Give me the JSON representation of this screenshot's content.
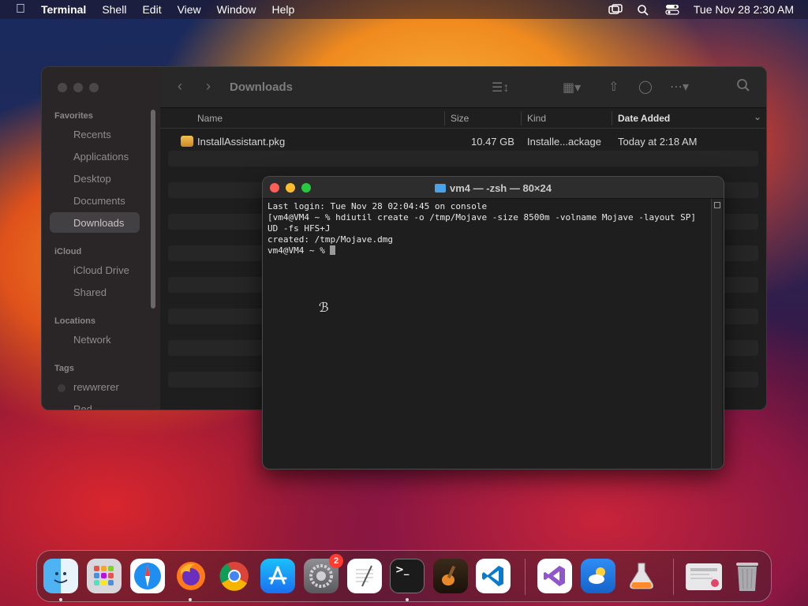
{
  "menubar": {
    "app_name": "Terminal",
    "items": [
      "Shell",
      "Edit",
      "View",
      "Window",
      "Help"
    ],
    "datetime": "Tue Nov 28  2:30 AM"
  },
  "finder": {
    "title": "Downloads",
    "sidebar": {
      "favorites_header": "Favorites",
      "favorites": [
        "Recents",
        "Applications",
        "Desktop",
        "Documents",
        "Downloads"
      ],
      "selected": "Downloads",
      "icloud_header": "iCloud",
      "icloud": [
        "iCloud Drive",
        "Shared"
      ],
      "locations_header": "Locations",
      "locations": [
        "Network"
      ],
      "tags_header": "Tags",
      "tags": [
        "rewwrerer",
        "Red"
      ]
    },
    "columns": {
      "name": "Name",
      "size": "Size",
      "kind": "Kind",
      "date_added": "Date Added"
    },
    "files": [
      {
        "name": "InstallAssistant.pkg",
        "size": "10.47 GB",
        "kind": "Installe...ackage",
        "date_added": "Today at 2:18 AM"
      }
    ]
  },
  "terminal": {
    "title": "vm4 — -zsh — 80×24",
    "lines": [
      "Last login: Tue Nov 28 02:04:45 on console",
      "[vm4@VM4 ~ % hdiutil create -o /tmp/Mojave -size 8500m -volname Mojave -layout SP]",
      "UD -fs HFS+J",
      "created: /tmp/Mojave.dmg"
    ],
    "prompt": "vm4@VM4 ~ % "
  },
  "dock": {
    "badge_settings": "2",
    "terminal_glyph": ">_"
  }
}
